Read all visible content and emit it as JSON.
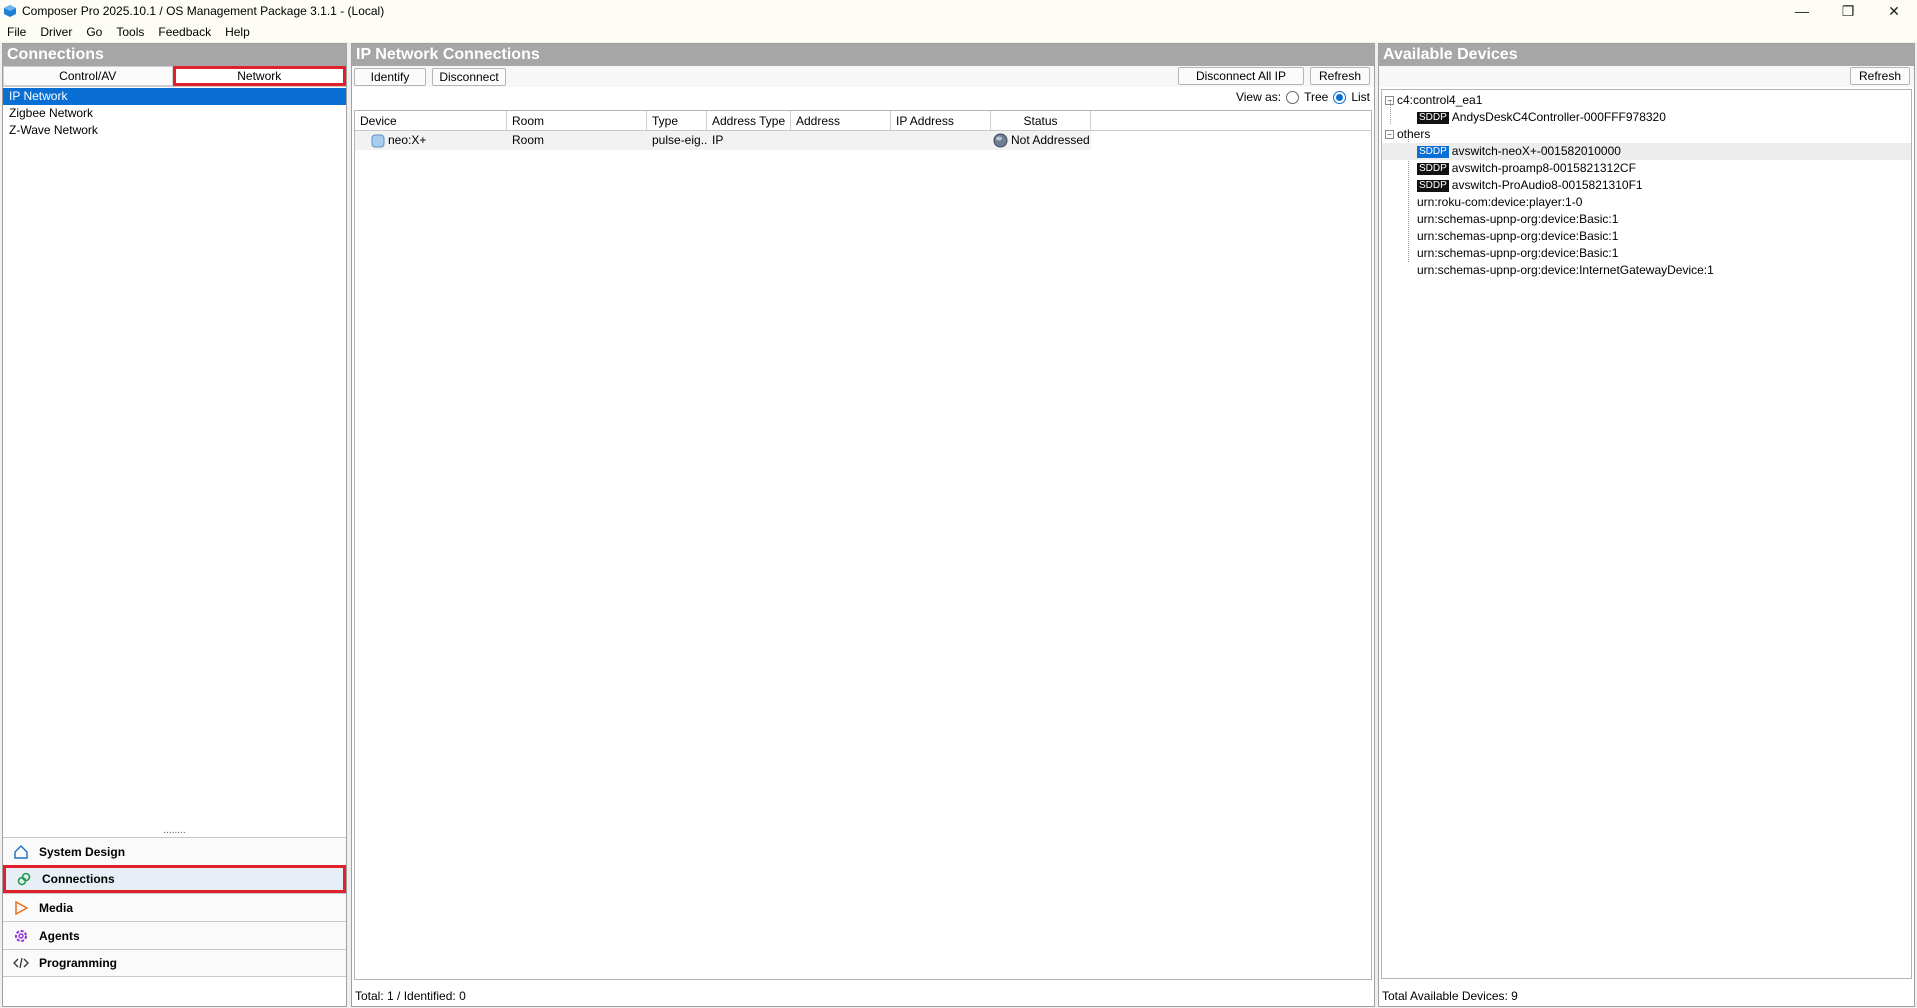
{
  "window": {
    "title": "Composer Pro 2025.10.1 / OS Management Package 3.1.1 - (Local)",
    "minimize": "—",
    "restore": "❐",
    "close": "✕"
  },
  "menu": [
    "File",
    "Driver",
    "Go",
    "Tools",
    "Feedback",
    "Help"
  ],
  "left": {
    "header": "Connections",
    "tabs": [
      "Control/AV",
      "Network"
    ],
    "networks": [
      "IP Network",
      "Zigbee Network",
      "Z-Wave Network"
    ],
    "splitter": "........",
    "nav": [
      "System Design",
      "Connections",
      "Media",
      "Agents",
      "Programming"
    ]
  },
  "middle": {
    "header": "IP Network Connections",
    "identify": "Identify",
    "disconnect": "Disconnect",
    "disconnect_all": "Disconnect All IP",
    "refresh": "Refresh",
    "view_as": "View as:",
    "tree": "Tree",
    "list": "List",
    "columns": [
      "Device",
      "Room",
      "Type",
      "Address Type",
      "Address",
      "IP Address",
      "Status"
    ],
    "row": {
      "device": "neo:X+",
      "room": "Room",
      "type": "pulse-eig...",
      "address_type": "IP",
      "address": "",
      "ip_address": "",
      "status": "Not Addressed"
    },
    "total": "Total: 1 / Identified: 0"
  },
  "right": {
    "header": "Available Devices",
    "refresh": "Refresh",
    "group1": "c4:control4_ea1",
    "group1_items": [
      {
        "tag": "SDDP",
        "name": "AndysDeskC4Controller-000FFF978320"
      }
    ],
    "group2": "others",
    "group2_sddp": [
      {
        "tag": "SDDP",
        "name": "avswitch-neoX+-001582010000"
      },
      {
        "tag": "SDDP",
        "name": "avswitch-proamp8-0015821312CF"
      },
      {
        "tag": "SDDP",
        "name": "avswitch-ProAudio8-0015821310F1"
      }
    ],
    "group2_other": [
      "urn:roku-com:device:player:1-0",
      "urn:schemas-upnp-org:device:Basic:1",
      "urn:schemas-upnp-org:device:Basic:1",
      "urn:schemas-upnp-org:device:Basic:1",
      "urn:schemas-upnp-org:device:InternetGatewayDevice:1"
    ],
    "total": "Total Available Devices: 9"
  },
  "colors": {
    "header_bg": "#a6a6a6",
    "selection": "#0a6fd4",
    "highlight_border": "#e0202a"
  }
}
